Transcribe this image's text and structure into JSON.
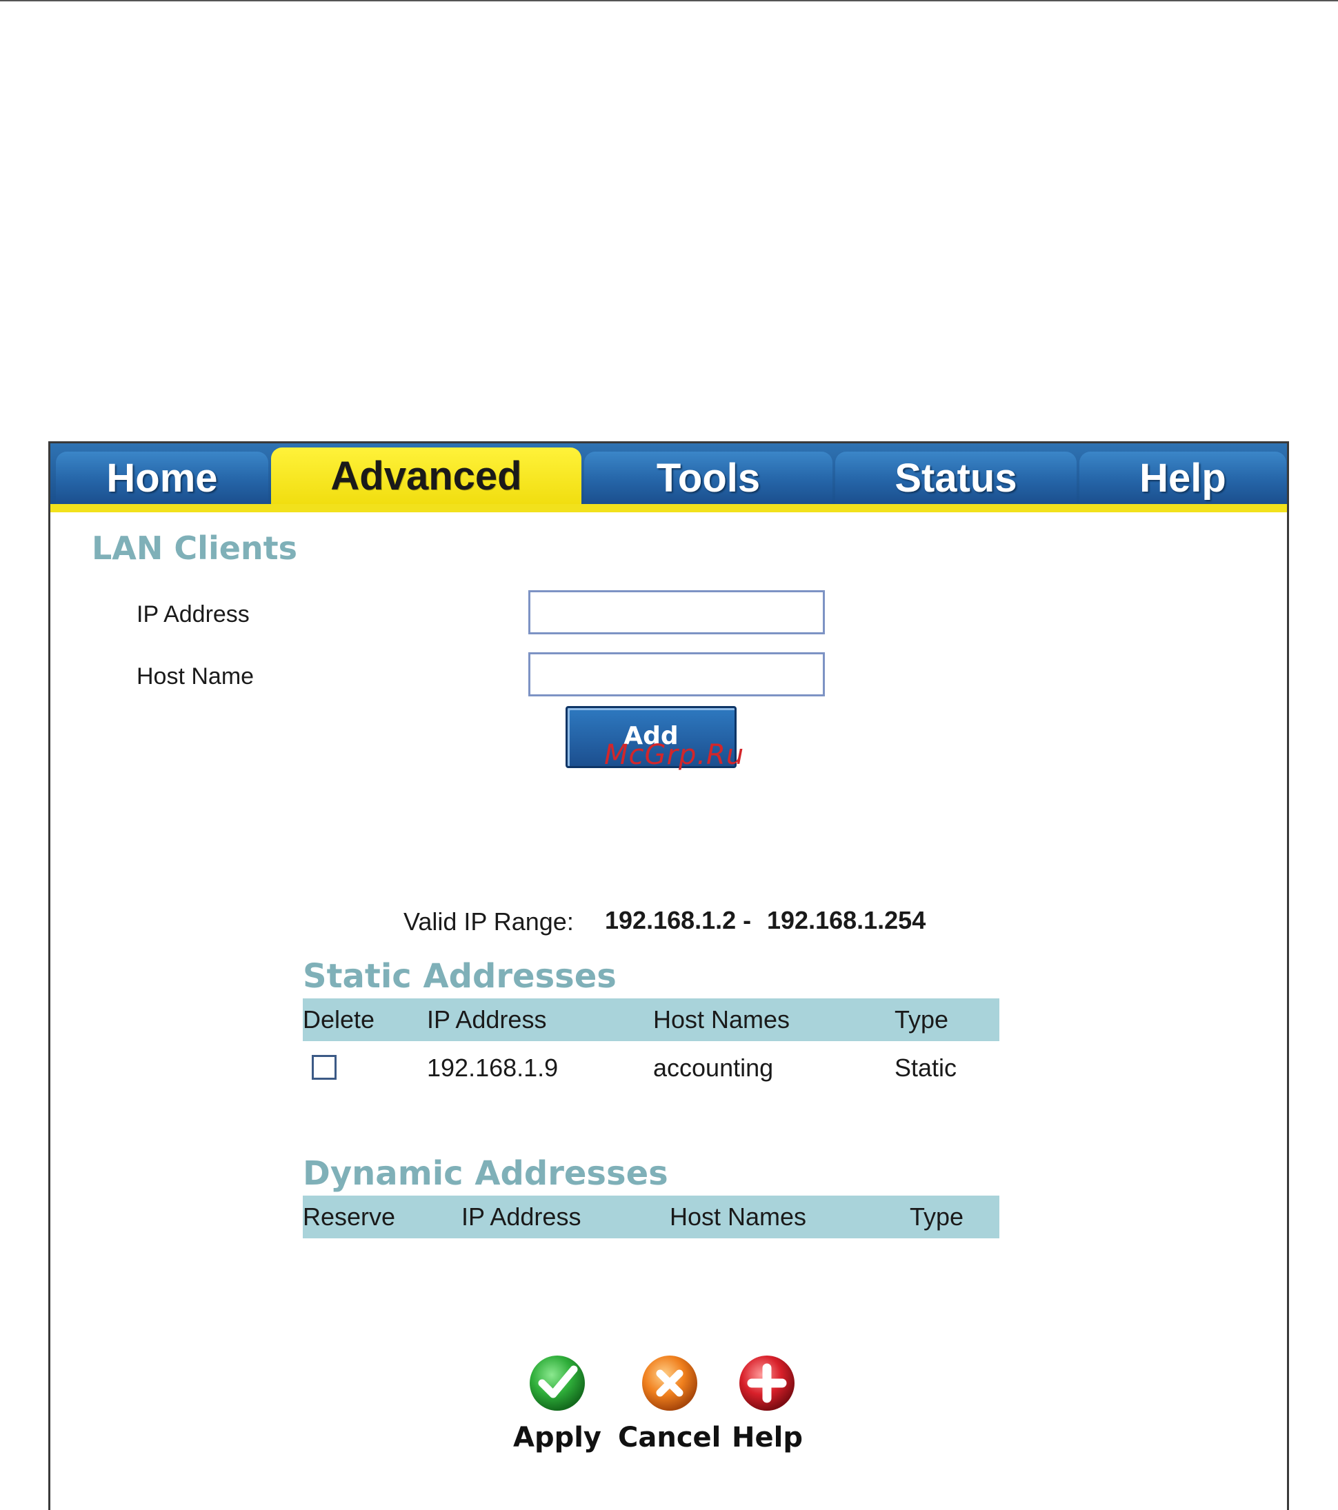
{
  "tabs": [
    {
      "label": "Home"
    },
    {
      "label": "Advanced"
    },
    {
      "label": "Tools"
    },
    {
      "label": "Status"
    },
    {
      "label": "Help"
    }
  ],
  "active_tab": "Advanced",
  "page_title": "LAN Clients",
  "form": {
    "ip_label": "IP Address",
    "ip_value": "",
    "host_label": "Host Name",
    "host_value": "",
    "add_label": "Add"
  },
  "watermark": "McGrp.Ru",
  "valid_range": {
    "label": "Valid IP Range:",
    "start": "192.168.1.2 -",
    "end": "192.168.1.254"
  },
  "static": {
    "title": "Static Addresses",
    "headers": [
      "Delete",
      "IP Address",
      "Host Names",
      "Type"
    ],
    "rows": [
      {
        "ip": "192.168.1.9",
        "host": "accounting",
        "type": "Static",
        "checked": false
      }
    ]
  },
  "dynamic": {
    "title": "Dynamic Addresses",
    "headers": [
      "Reserve",
      "IP Address",
      "Host Names",
      "Type"
    ],
    "rows": []
  },
  "actions": {
    "apply": "Apply",
    "cancel": "Cancel",
    "help": "Help"
  },
  "colors": {
    "tab_blue": "#2565a8",
    "tab_active_yellow": "#f2e11c",
    "section_title": "#7fb0b8",
    "table_header": "#a9d3da",
    "apply_green": "#2fae3a",
    "cancel_orange": "#f0801e",
    "help_red": "#d8202a"
  }
}
